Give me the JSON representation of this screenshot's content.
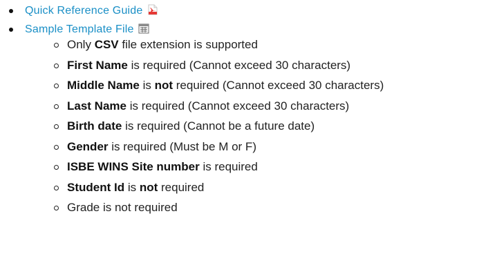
{
  "links": [
    {
      "label": "Quick Reference Guide",
      "icon": "pdf-icon"
    },
    {
      "label": "Sample Template File",
      "icon": "csv-icon"
    }
  ],
  "rules": [
    {
      "pre": "Only ",
      "bold": "CSV",
      "post": " file extension is supported"
    },
    {
      "pre": "",
      "bold": "First Name",
      "post": " is required (Cannot exceed 30 characters)"
    },
    {
      "pre": "",
      "bold": "Middle Name",
      "post": " is ",
      "bold2": "not",
      "post2": " required (Cannot exceed 30 characters)"
    },
    {
      "pre": "",
      "bold": "Last Name",
      "post": " is required (Cannot exceed 30 characters)"
    },
    {
      "pre": "",
      "bold": "Birth date",
      "post": " is required (Cannot be a future date)"
    },
    {
      "pre": "",
      "bold": "Gender",
      "post": " is required (Must be M or F)"
    },
    {
      "pre": "",
      "bold": "ISBE WINS Site number",
      "post": " is required"
    },
    {
      "pre": "",
      "bold": "Student Id",
      "post": " is ",
      "bold2": "not",
      "post2": " required"
    },
    {
      "pre": "Grade is not required",
      "bold": "",
      "post": ""
    }
  ],
  "colors": {
    "link": "#1a8fc6",
    "pdf_icon": "#e53935",
    "text": "#222222"
  }
}
